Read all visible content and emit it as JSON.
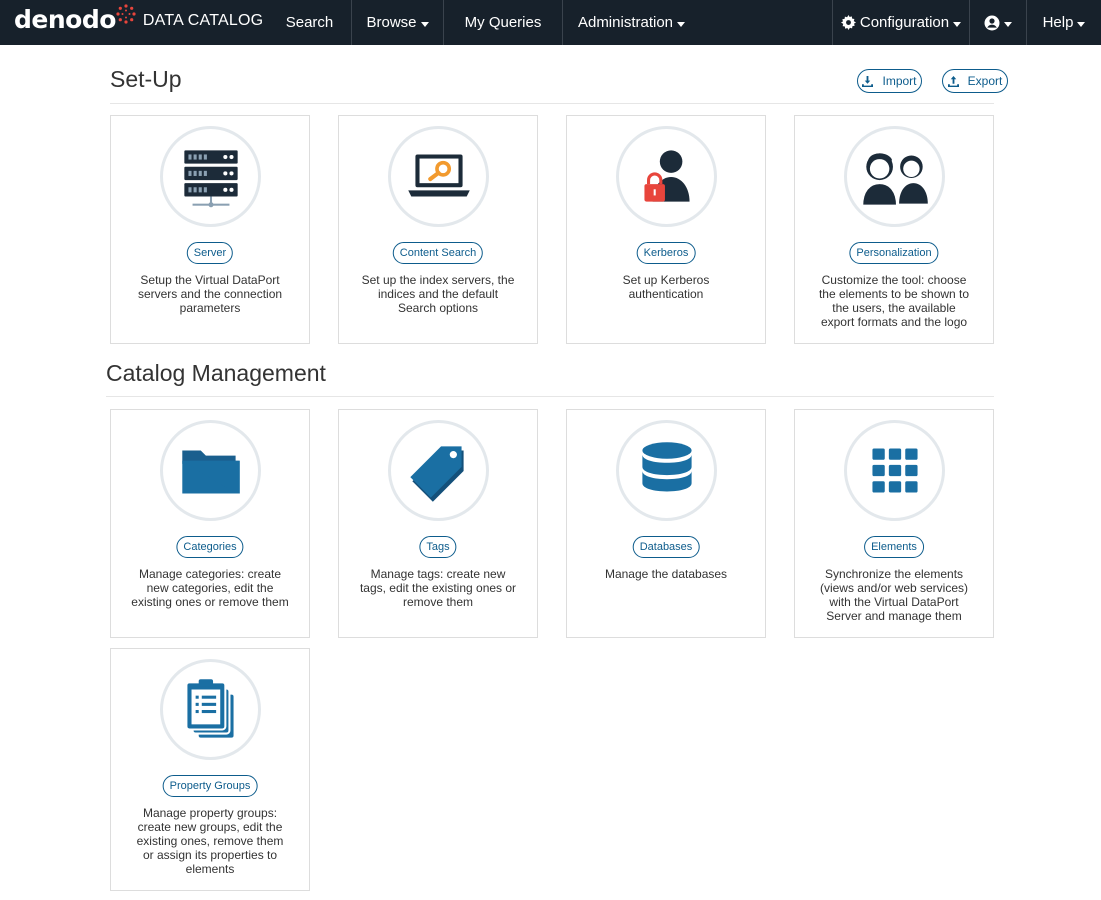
{
  "navbar": {
    "brand_logo": "denodo",
    "brand_name": "DATA CATALOG",
    "search": "Search",
    "browse": "Browse",
    "my_queries": "My Queries",
    "administration": "Administration",
    "configuration": "Configuration",
    "help": "Help"
  },
  "setup": {
    "title": "Set-Up",
    "import_label": "Import",
    "export_label": "Export",
    "cards": [
      {
        "label": "Server",
        "desc": "Setup the Virtual DataPort servers and the connection parameters",
        "icon": "server-icon"
      },
      {
        "label": "Content Search",
        "desc": "Set up the index servers, the indices and the default Search options",
        "icon": "laptop-search-icon"
      },
      {
        "label": "Kerberos",
        "desc": "Set up Kerberos authentication",
        "icon": "user-lock-icon"
      },
      {
        "label": "Personalization",
        "desc": "Customize the tool: choose the elements to be shown to the users, the available export formats and the logo",
        "icon": "users-icon"
      }
    ]
  },
  "catalog": {
    "title": "Catalog Management",
    "cards": [
      {
        "label": "Categories",
        "desc": "Manage categories: create new categories, edit the existing ones or remove them",
        "icon": "folder-icon"
      },
      {
        "label": "Tags",
        "desc": "Manage tags: create new tags, edit the existing ones or remove them",
        "icon": "tag-icon"
      },
      {
        "label": "Databases",
        "desc": "Manage the databases",
        "icon": "database-icon"
      },
      {
        "label": "Elements",
        "desc": "Synchronize the elements (views and/or web services) with the Virtual DataPort Server and manage them",
        "icon": "grid-icon"
      },
      {
        "label": "Property Groups",
        "desc": "Manage property groups: create new groups, edit the existing ones, remove them or assign its properties to elements",
        "icon": "clipboard-icon"
      }
    ]
  },
  "colors": {
    "navbar_bg": "#17212b",
    "accent": "#0d5c8c",
    "icon_dark": "#1c2b39",
    "icon_blue": "#1a6fa3",
    "lock_red": "#e8453c",
    "search_orange": "#f29a2e"
  }
}
